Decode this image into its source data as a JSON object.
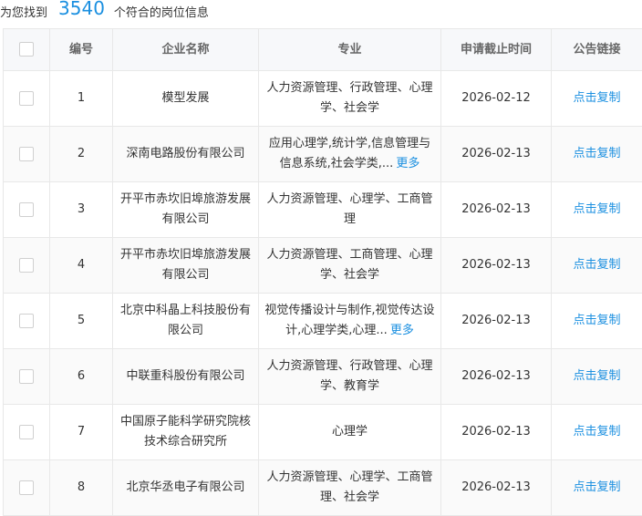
{
  "summary": {
    "prefix": "为您找到",
    "count": "3540",
    "suffix": "个符合的岗位信息"
  },
  "table": {
    "headers": {
      "number": "编号",
      "company": "企业名称",
      "major": "专业",
      "deadline": "申请截止时间",
      "notice": "公告链接"
    },
    "rows": [
      {
        "number": "1",
        "company": "模型发展",
        "major": "人力资源管理、行政管理、心理学、社会学",
        "more": "",
        "deadline": "2026-02-12",
        "link": "点击复制"
      },
      {
        "number": "2",
        "company": "深南电路股份有限公司",
        "major": "应用心理学,统计学,信息管理与信息系统,社会学类,...",
        "more": "更多",
        "deadline": "2026-02-13",
        "link": "点击复制"
      },
      {
        "number": "3",
        "company": "开平市赤坎旧埠旅游发展有限公司",
        "major": "人力资源管理、心理学、工商管理",
        "more": "",
        "deadline": "2026-02-13",
        "link": "点击复制"
      },
      {
        "number": "4",
        "company": "开平市赤坎旧埠旅游发展有限公司",
        "major": "人力资源管理、工商管理、心理学、社会学",
        "more": "",
        "deadline": "2026-02-13",
        "link": "点击复制"
      },
      {
        "number": "5",
        "company": "北京中科晶上科技股份有限公司",
        "major": "视觉传播设计与制作,视觉传达设计,心理学类,心理...",
        "more": "更多",
        "deadline": "2026-02-13",
        "link": "点击复制"
      },
      {
        "number": "6",
        "company": "中联重科股份有限公司",
        "major": "人力资源管理、行政管理、心理学、教育学",
        "more": "",
        "deadline": "2026-02-13",
        "link": "点击复制"
      },
      {
        "number": "7",
        "company": "中国原子能科学研究院核技术综合研究所",
        "major": "心理学",
        "more": "",
        "deadline": "2026-02-13",
        "link": "点击复制"
      },
      {
        "number": "8",
        "company": "北京华丞电子有限公司",
        "major": "人力资源管理、心理学、工商管理、社会学",
        "more": "",
        "deadline": "2026-02-13",
        "link": "点击复制"
      }
    ]
  }
}
